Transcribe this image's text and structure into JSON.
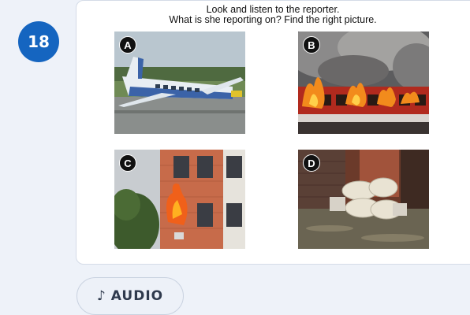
{
  "question": {
    "number": "18",
    "instruction_line1": "Look and listen to the reporter.",
    "instruction_line2": "What is she reporting on? Find the right picture."
  },
  "pictures": [
    {
      "letter": "A",
      "subject": "plane-crash"
    },
    {
      "letter": "B",
      "subject": "burning-train"
    },
    {
      "letter": "C",
      "subject": "building-fire"
    },
    {
      "letter": "D",
      "subject": "flood-sandbags"
    }
  ],
  "audio": {
    "icon": "music-note-icon",
    "label": "AUDIO"
  },
  "colors": {
    "badge": "#1565c0",
    "page_background": "#eef2f9",
    "card_background": "#ffffff"
  }
}
